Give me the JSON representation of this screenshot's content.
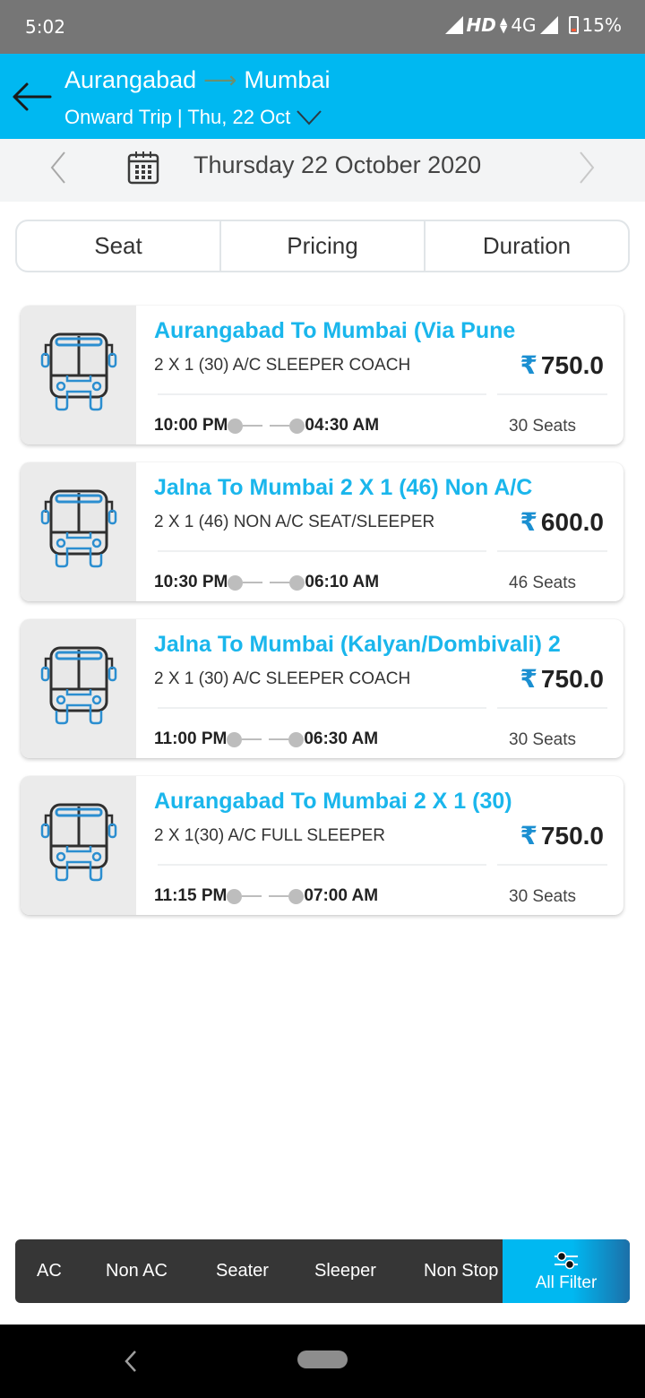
{
  "status_bar": {
    "time": "5:02",
    "network": "HD",
    "network_type": "4G",
    "battery": "15%"
  },
  "header": {
    "from": "Aurangabad",
    "to": "Mumbai",
    "arrow": "⟶",
    "subtitle": "Onward Trip | Thu, 22 Oct",
    "back_icon": "arrow-left-icon",
    "dropdown_icon": "chevron-down-icon"
  },
  "date_bar": {
    "date": "Thursday 22 October 2020",
    "prev_icon": "chevron-left-icon",
    "next_icon": "chevron-right-icon",
    "calendar_icon": "calendar-icon"
  },
  "sort_tabs": [
    "Seat",
    "Pricing",
    "Duration"
  ],
  "currency_symbol": "₹",
  "buses": [
    {
      "title": "Aurangabad To Mumbai (Via Pune",
      "type": "2 X 1 (30) A/C SLEEPER COACH",
      "price": "750.0",
      "departure": "10:00 PM",
      "arrival": "04:30 AM",
      "seats": "30 Seats"
    },
    {
      "title": "Jalna To Mumbai 2 X 1 (46) Non A/C",
      "type": "2 X 1 (46) NON A/C SEAT/SLEEPER",
      "price": "600.0",
      "departure": "10:30 PM",
      "arrival": "06:10 AM",
      "seats": "46 Seats"
    },
    {
      "title": "Jalna To Mumbai (Kalyan/Dombivali) 2",
      "type": "2 X 1 (30) A/C SLEEPER COACH",
      "price": "750.0",
      "departure": "11:00 PM",
      "arrival": "06:30 AM",
      "seats": "30 Seats"
    },
    {
      "title": "Aurangabad To Mumbai 2 X 1 (30)",
      "type": "2 X 1(30) A/C FULL SLEEPER",
      "price": "750.0",
      "departure": "11:15 PM",
      "arrival": "07:00 AM",
      "seats": "30 Seats"
    }
  ],
  "filters": {
    "items": [
      "AC",
      "Non AC",
      "Seater",
      "Sleeper",
      "Non Stop"
    ],
    "all_filter_label": "All Filter",
    "all_filter_icon": "sliders-icon"
  },
  "colors": {
    "accent": "#00b8f1",
    "title_blue": "#1ab6ec",
    "filter_bar": "#363636"
  }
}
